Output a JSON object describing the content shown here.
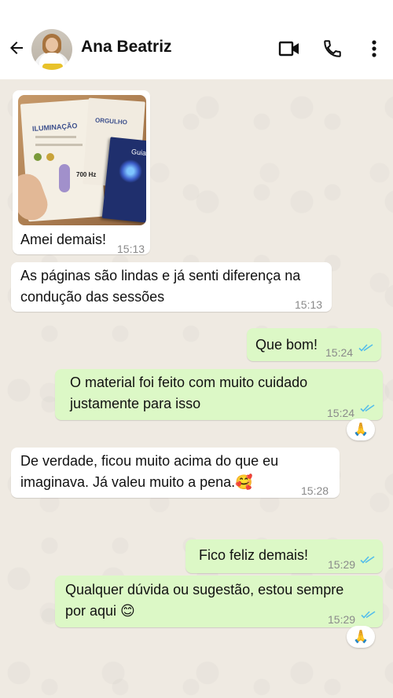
{
  "header": {
    "contact_name": "Ana Beatriz"
  },
  "icons": {
    "back": "arrow-left-icon",
    "video": "video-camera-icon",
    "call": "phone-icon",
    "menu": "more-vertical-icon"
  },
  "colors": {
    "incoming_bubble": "#ffffff",
    "outgoing_bubble": "#dcf8c6",
    "read_ticks": "#53bdeb",
    "chat_background": "#efeae2"
  },
  "photo": {
    "leaflet_title": "ILUMINAÇÃO",
    "leaflet_title_right": "ORGULHO",
    "frequency": "700 Hz",
    "book_title": "Guia"
  },
  "messages": [
    {
      "direction": "in",
      "text": "Amei demais!",
      "time": "15:13",
      "has_image": true
    },
    {
      "direction": "in",
      "text": "As páginas são lindas e já senti diferença na condução das sessões",
      "time": "15:13"
    },
    {
      "direction": "out",
      "text": "Que bom!",
      "time": "15:24",
      "status": "read"
    },
    {
      "direction": "out",
      "text": "O material foi feito com muito cuidado justamente para isso",
      "time": "15:24",
      "status": "read",
      "reaction": "🙏"
    },
    {
      "direction": "in",
      "text": "De verdade, ficou muito acima do que eu imaginava. Já valeu muito a pena.🥰",
      "time": "15:28"
    },
    {
      "direction": "out",
      "text": "Fico feliz demais!",
      "time": "15:29",
      "status": "read"
    },
    {
      "direction": "out",
      "text": "Qualquer dúvida ou sugestão, estou sempre por aqui 😊",
      "time": "15:29",
      "status": "read",
      "reaction": "🙏"
    }
  ],
  "lines": {
    "m1": [
      "As páginas são lindas e já senti diferença na",
      "condução das sessões"
    ],
    "m3": [
      "O material foi feito com muito cuidado",
      "justamente para isso"
    ],
    "m4": [
      "De verdade, ficou muito acima do que eu",
      "imaginava. Já valeu muito a pena.🥰"
    ],
    "m6": [
      "Qualquer dúvida ou sugestão, estou sempre",
      "por aqui 😊"
    ]
  }
}
